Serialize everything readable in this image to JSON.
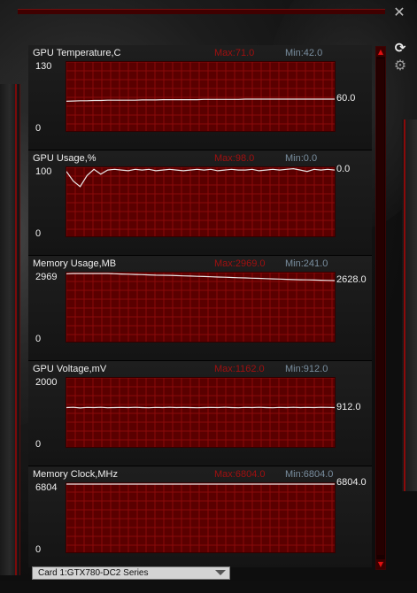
{
  "window": {
    "close_icon": "✕",
    "link_icon": "⟳",
    "gear_icon": "⚙"
  },
  "scroll": {
    "up": "▲",
    "down": "▼"
  },
  "panels": [
    {
      "title": "GPU Temperature,C",
      "max_label": "Max:71.0",
      "min_label": "Min:42.0",
      "y_top": "130",
      "y_bottom": "0",
      "current": "60.0",
      "ymin": 0,
      "ymax": 130,
      "values": [
        56,
        56.5,
        57,
        57,
        57.5,
        57.5,
        58,
        58,
        58,
        58,
        58,
        58.5,
        58.5,
        58.5,
        59,
        59,
        59,
        59,
        59,
        59,
        59.5,
        59.5,
        59.5,
        59.5,
        59.5,
        59.5,
        60,
        60,
        60,
        60,
        60,
        60,
        60,
        60,
        60,
        60,
        60,
        60,
        60,
        60
      ]
    },
    {
      "title": "GPU Usage,%",
      "max_label": "Max:98.0",
      "min_label": "Min:0.0",
      "y_top": "100",
      "y_bottom": "0",
      "current": "0.0",
      "ymin": 0,
      "ymax": 100,
      "values": [
        94,
        80,
        72,
        88,
        97,
        90,
        96,
        97,
        96,
        95,
        97,
        96,
        97,
        95,
        96,
        97,
        96,
        95,
        96,
        97,
        96,
        97,
        95,
        96,
        97,
        96,
        96,
        97,
        95,
        96,
        97,
        96,
        97,
        98,
        96,
        94,
        97,
        96,
        97,
        96
      ]
    },
    {
      "title": "Memory Usage,MB",
      "max_label": "Max:2969.0",
      "min_label": "Min:241.0",
      "y_top": "2969",
      "y_bottom": "0",
      "current": "2628.0",
      "ymin": 0,
      "ymax": 2969,
      "values": [
        2920,
        2935,
        2950,
        2960,
        2969,
        2960,
        2940,
        2920,
        2910,
        2900,
        2890,
        2880,
        2870,
        2860,
        2855,
        2850,
        2840,
        2830,
        2820,
        2810,
        2800,
        2790,
        2780,
        2770,
        2760,
        2750,
        2740,
        2730,
        2720,
        2710,
        2700,
        2690,
        2680,
        2670,
        2660,
        2655,
        2650,
        2640,
        2635,
        2628
      ]
    },
    {
      "title": "GPU Voltage,mV",
      "max_label": "Max:1162.0",
      "min_label": "Min:912.0",
      "y_top": "2000",
      "y_bottom": "0",
      "current": "912.0",
      "ymin": 0,
      "ymax": 2000,
      "values": [
        1140,
        1150,
        1130,
        1145,
        1140,
        1150,
        1135,
        1140,
        1145,
        1140,
        1150,
        1140,
        1135,
        1145,
        1140,
        1150,
        1140,
        1145,
        1140,
        1135,
        1140,
        1145,
        1140,
        1150,
        1140,
        1135,
        1145,
        1140,
        1150,
        1140,
        1135,
        1145,
        1140,
        1150,
        1140,
        1145,
        1140,
        1150,
        1145,
        1140
      ]
    },
    {
      "title": "Memory Clock,MHz",
      "max_label": "Max:6804.0",
      "min_label": "Min:6804.0",
      "y_top": "6804",
      "y_bottom": "0",
      "current": "6804.0",
      "ymin": 0,
      "ymax": 6804,
      "values": [
        6804,
        6804,
        6804,
        6804,
        6804,
        6804,
        6804,
        6804,
        6804,
        6804,
        6804,
        6804,
        6804,
        6804,
        6804,
        6804,
        6804,
        6804,
        6804,
        6804,
        6804,
        6804,
        6804,
        6804,
        6804,
        6804,
        6804,
        6804,
        6804,
        6804,
        6804,
        6804,
        6804,
        6804,
        6804,
        6804,
        6804,
        6804,
        6804,
        6804
      ]
    }
  ],
  "card": {
    "label": "Card 1:GTX780-DC2 Series"
  },
  "colors": {
    "plot_bg": "#5a0000",
    "grid": "#8a0a0a",
    "line": "#e8e8e8",
    "max_text": "#a01010",
    "min_text": "#7a8fa0"
  }
}
